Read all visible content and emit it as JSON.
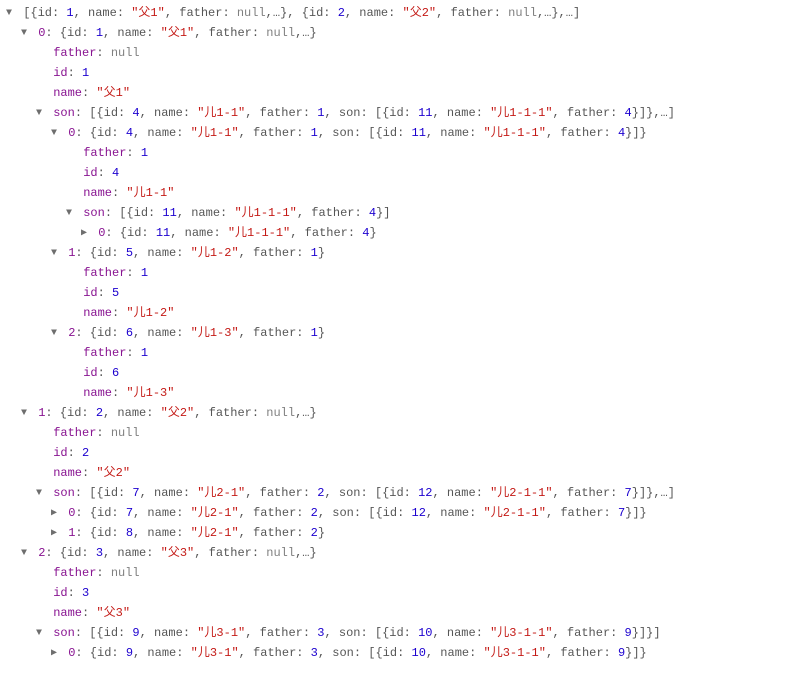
{
  "indentUnit": 15,
  "arrowBase": 2,
  "arrows": {
    "down": "▼",
    "right": "▶",
    "none": " "
  },
  "rows": [
    {
      "depth": 0,
      "arrow": "down",
      "tokens": [
        {
          "t": "pun",
          "v": "[{"
        },
        {
          "t": "pun",
          "v": "id: "
        },
        {
          "t": "num",
          "v": "1"
        },
        {
          "t": "pun",
          "v": ", name: "
        },
        {
          "t": "str",
          "v": "\"父1\""
        },
        {
          "t": "pun",
          "v": ", father: "
        },
        {
          "t": "nul",
          "v": "null"
        },
        {
          "t": "pun",
          "v": ",…}, {id: "
        },
        {
          "t": "num",
          "v": "2"
        },
        {
          "t": "pun",
          "v": ", name: "
        },
        {
          "t": "str",
          "v": "\"父2\""
        },
        {
          "t": "pun",
          "v": ", father: "
        },
        {
          "t": "nul",
          "v": "null"
        },
        {
          "t": "pun",
          "v": ",…},…]"
        }
      ]
    },
    {
      "depth": 1,
      "arrow": "down",
      "tokens": [
        {
          "t": "key",
          "v": "0"
        },
        {
          "t": "pun",
          "v": ": {id: "
        },
        {
          "t": "num",
          "v": "1"
        },
        {
          "t": "pun",
          "v": ", name: "
        },
        {
          "t": "str",
          "v": "\"父1\""
        },
        {
          "t": "pun",
          "v": ", father: "
        },
        {
          "t": "nul",
          "v": "null"
        },
        {
          "t": "pun",
          "v": ",…}"
        }
      ]
    },
    {
      "depth": 2,
      "arrow": "none",
      "tokens": [
        {
          "t": "key",
          "v": "father"
        },
        {
          "t": "pun",
          "v": ": "
        },
        {
          "t": "nul",
          "v": "null"
        }
      ]
    },
    {
      "depth": 2,
      "arrow": "none",
      "tokens": [
        {
          "t": "key",
          "v": "id"
        },
        {
          "t": "pun",
          "v": ": "
        },
        {
          "t": "num",
          "v": "1"
        }
      ]
    },
    {
      "depth": 2,
      "arrow": "none",
      "tokens": [
        {
          "t": "key",
          "v": "name"
        },
        {
          "t": "pun",
          "v": ": "
        },
        {
          "t": "str",
          "v": "\"父1\""
        }
      ]
    },
    {
      "depth": 2,
      "arrow": "down",
      "tokens": [
        {
          "t": "key",
          "v": "son"
        },
        {
          "t": "pun",
          "v": ": [{id: "
        },
        {
          "t": "num",
          "v": "4"
        },
        {
          "t": "pun",
          "v": ", name: "
        },
        {
          "t": "str",
          "v": "\"儿1-1\""
        },
        {
          "t": "pun",
          "v": ", father: "
        },
        {
          "t": "num",
          "v": "1"
        },
        {
          "t": "pun",
          "v": ", son: [{id: "
        },
        {
          "t": "num",
          "v": "11"
        },
        {
          "t": "pun",
          "v": ", name: "
        },
        {
          "t": "str",
          "v": "\"儿1-1-1\""
        },
        {
          "t": "pun",
          "v": ", father: "
        },
        {
          "t": "num",
          "v": "4"
        },
        {
          "t": "pun",
          "v": "}]},…]"
        }
      ]
    },
    {
      "depth": 3,
      "arrow": "down",
      "tokens": [
        {
          "t": "key",
          "v": "0"
        },
        {
          "t": "pun",
          "v": ": {id: "
        },
        {
          "t": "num",
          "v": "4"
        },
        {
          "t": "pun",
          "v": ", name: "
        },
        {
          "t": "str",
          "v": "\"儿1-1\""
        },
        {
          "t": "pun",
          "v": ", father: "
        },
        {
          "t": "num",
          "v": "1"
        },
        {
          "t": "pun",
          "v": ", son: [{id: "
        },
        {
          "t": "num",
          "v": "11"
        },
        {
          "t": "pun",
          "v": ", name: "
        },
        {
          "t": "str",
          "v": "\"儿1-1-1\""
        },
        {
          "t": "pun",
          "v": ", father: "
        },
        {
          "t": "num",
          "v": "4"
        },
        {
          "t": "pun",
          "v": "}]}"
        }
      ]
    },
    {
      "depth": 4,
      "arrow": "none",
      "tokens": [
        {
          "t": "key",
          "v": "father"
        },
        {
          "t": "pun",
          "v": ": "
        },
        {
          "t": "num",
          "v": "1"
        }
      ]
    },
    {
      "depth": 4,
      "arrow": "none",
      "tokens": [
        {
          "t": "key",
          "v": "id"
        },
        {
          "t": "pun",
          "v": ": "
        },
        {
          "t": "num",
          "v": "4"
        }
      ]
    },
    {
      "depth": 4,
      "arrow": "none",
      "tokens": [
        {
          "t": "key",
          "v": "name"
        },
        {
          "t": "pun",
          "v": ": "
        },
        {
          "t": "str",
          "v": "\"儿1-1\""
        }
      ]
    },
    {
      "depth": 4,
      "arrow": "down",
      "tokens": [
        {
          "t": "key",
          "v": "son"
        },
        {
          "t": "pun",
          "v": ": [{id: "
        },
        {
          "t": "num",
          "v": "11"
        },
        {
          "t": "pun",
          "v": ", name: "
        },
        {
          "t": "str",
          "v": "\"儿1-1-1\""
        },
        {
          "t": "pun",
          "v": ", father: "
        },
        {
          "t": "num",
          "v": "4"
        },
        {
          "t": "pun",
          "v": "}]"
        }
      ]
    },
    {
      "depth": 5,
      "arrow": "right",
      "tokens": [
        {
          "t": "key",
          "v": "0"
        },
        {
          "t": "pun",
          "v": ": {id: "
        },
        {
          "t": "num",
          "v": "11"
        },
        {
          "t": "pun",
          "v": ", name: "
        },
        {
          "t": "str",
          "v": "\"儿1-1-1\""
        },
        {
          "t": "pun",
          "v": ", father: "
        },
        {
          "t": "num",
          "v": "4"
        },
        {
          "t": "pun",
          "v": "}"
        }
      ]
    },
    {
      "depth": 3,
      "arrow": "down",
      "tokens": [
        {
          "t": "key",
          "v": "1"
        },
        {
          "t": "pun",
          "v": ": {id: "
        },
        {
          "t": "num",
          "v": "5"
        },
        {
          "t": "pun",
          "v": ", name: "
        },
        {
          "t": "str",
          "v": "\"儿1-2\""
        },
        {
          "t": "pun",
          "v": ", father: "
        },
        {
          "t": "num",
          "v": "1"
        },
        {
          "t": "pun",
          "v": "}"
        }
      ]
    },
    {
      "depth": 4,
      "arrow": "none",
      "tokens": [
        {
          "t": "key",
          "v": "father"
        },
        {
          "t": "pun",
          "v": ": "
        },
        {
          "t": "num",
          "v": "1"
        }
      ]
    },
    {
      "depth": 4,
      "arrow": "none",
      "tokens": [
        {
          "t": "key",
          "v": "id"
        },
        {
          "t": "pun",
          "v": ": "
        },
        {
          "t": "num",
          "v": "5"
        }
      ]
    },
    {
      "depth": 4,
      "arrow": "none",
      "tokens": [
        {
          "t": "key",
          "v": "name"
        },
        {
          "t": "pun",
          "v": ": "
        },
        {
          "t": "str",
          "v": "\"儿1-2\""
        }
      ]
    },
    {
      "depth": 3,
      "arrow": "down",
      "tokens": [
        {
          "t": "key",
          "v": "2"
        },
        {
          "t": "pun",
          "v": ": {id: "
        },
        {
          "t": "num",
          "v": "6"
        },
        {
          "t": "pun",
          "v": ", name: "
        },
        {
          "t": "str",
          "v": "\"儿1-3\""
        },
        {
          "t": "pun",
          "v": ", father: "
        },
        {
          "t": "num",
          "v": "1"
        },
        {
          "t": "pun",
          "v": "}"
        }
      ]
    },
    {
      "depth": 4,
      "arrow": "none",
      "tokens": [
        {
          "t": "key",
          "v": "father"
        },
        {
          "t": "pun",
          "v": ": "
        },
        {
          "t": "num",
          "v": "1"
        }
      ]
    },
    {
      "depth": 4,
      "arrow": "none",
      "tokens": [
        {
          "t": "key",
          "v": "id"
        },
        {
          "t": "pun",
          "v": ": "
        },
        {
          "t": "num",
          "v": "6"
        }
      ]
    },
    {
      "depth": 4,
      "arrow": "none",
      "tokens": [
        {
          "t": "key",
          "v": "name"
        },
        {
          "t": "pun",
          "v": ": "
        },
        {
          "t": "str",
          "v": "\"儿1-3\""
        }
      ]
    },
    {
      "depth": 1,
      "arrow": "down",
      "tokens": [
        {
          "t": "key",
          "v": "1"
        },
        {
          "t": "pun",
          "v": ": {id: "
        },
        {
          "t": "num",
          "v": "2"
        },
        {
          "t": "pun",
          "v": ", name: "
        },
        {
          "t": "str",
          "v": "\"父2\""
        },
        {
          "t": "pun",
          "v": ", father: "
        },
        {
          "t": "nul",
          "v": "null"
        },
        {
          "t": "pun",
          "v": ",…}"
        }
      ]
    },
    {
      "depth": 2,
      "arrow": "none",
      "tokens": [
        {
          "t": "key",
          "v": "father"
        },
        {
          "t": "pun",
          "v": ": "
        },
        {
          "t": "nul",
          "v": "null"
        }
      ]
    },
    {
      "depth": 2,
      "arrow": "none",
      "tokens": [
        {
          "t": "key",
          "v": "id"
        },
        {
          "t": "pun",
          "v": ": "
        },
        {
          "t": "num",
          "v": "2"
        }
      ]
    },
    {
      "depth": 2,
      "arrow": "none",
      "tokens": [
        {
          "t": "key",
          "v": "name"
        },
        {
          "t": "pun",
          "v": ": "
        },
        {
          "t": "str",
          "v": "\"父2\""
        }
      ]
    },
    {
      "depth": 2,
      "arrow": "down",
      "tokens": [
        {
          "t": "key",
          "v": "son"
        },
        {
          "t": "pun",
          "v": ": [{id: "
        },
        {
          "t": "num",
          "v": "7"
        },
        {
          "t": "pun",
          "v": ", name: "
        },
        {
          "t": "str",
          "v": "\"儿2-1\""
        },
        {
          "t": "pun",
          "v": ", father: "
        },
        {
          "t": "num",
          "v": "2"
        },
        {
          "t": "pun",
          "v": ", son: [{id: "
        },
        {
          "t": "num",
          "v": "12"
        },
        {
          "t": "pun",
          "v": ", name: "
        },
        {
          "t": "str",
          "v": "\"儿2-1-1\""
        },
        {
          "t": "pun",
          "v": ", father: "
        },
        {
          "t": "num",
          "v": "7"
        },
        {
          "t": "pun",
          "v": "}]},…]"
        }
      ]
    },
    {
      "depth": 3,
      "arrow": "right",
      "tokens": [
        {
          "t": "key",
          "v": "0"
        },
        {
          "t": "pun",
          "v": ": {id: "
        },
        {
          "t": "num",
          "v": "7"
        },
        {
          "t": "pun",
          "v": ", name: "
        },
        {
          "t": "str",
          "v": "\"儿2-1\""
        },
        {
          "t": "pun",
          "v": ", father: "
        },
        {
          "t": "num",
          "v": "2"
        },
        {
          "t": "pun",
          "v": ", son: [{id: "
        },
        {
          "t": "num",
          "v": "12"
        },
        {
          "t": "pun",
          "v": ", name: "
        },
        {
          "t": "str",
          "v": "\"儿2-1-1\""
        },
        {
          "t": "pun",
          "v": ", father: "
        },
        {
          "t": "num",
          "v": "7"
        },
        {
          "t": "pun",
          "v": "}]}"
        }
      ]
    },
    {
      "depth": 3,
      "arrow": "right",
      "tokens": [
        {
          "t": "key",
          "v": "1"
        },
        {
          "t": "pun",
          "v": ": {id: "
        },
        {
          "t": "num",
          "v": "8"
        },
        {
          "t": "pun",
          "v": ", name: "
        },
        {
          "t": "str",
          "v": "\"儿2-1\""
        },
        {
          "t": "pun",
          "v": ", father: "
        },
        {
          "t": "num",
          "v": "2"
        },
        {
          "t": "pun",
          "v": "}"
        }
      ]
    },
    {
      "depth": 1,
      "arrow": "down",
      "tokens": [
        {
          "t": "key",
          "v": "2"
        },
        {
          "t": "pun",
          "v": ": {id: "
        },
        {
          "t": "num",
          "v": "3"
        },
        {
          "t": "pun",
          "v": ", name: "
        },
        {
          "t": "str",
          "v": "\"父3\""
        },
        {
          "t": "pun",
          "v": ", father: "
        },
        {
          "t": "nul",
          "v": "null"
        },
        {
          "t": "pun",
          "v": ",…}"
        }
      ]
    },
    {
      "depth": 2,
      "arrow": "none",
      "tokens": [
        {
          "t": "key",
          "v": "father"
        },
        {
          "t": "pun",
          "v": ": "
        },
        {
          "t": "nul",
          "v": "null"
        }
      ]
    },
    {
      "depth": 2,
      "arrow": "none",
      "tokens": [
        {
          "t": "key",
          "v": "id"
        },
        {
          "t": "pun",
          "v": ": "
        },
        {
          "t": "num",
          "v": "3"
        }
      ]
    },
    {
      "depth": 2,
      "arrow": "none",
      "tokens": [
        {
          "t": "key",
          "v": "name"
        },
        {
          "t": "pun",
          "v": ": "
        },
        {
          "t": "str",
          "v": "\"父3\""
        }
      ]
    },
    {
      "depth": 2,
      "arrow": "down",
      "tokens": [
        {
          "t": "key",
          "v": "son"
        },
        {
          "t": "pun",
          "v": ": [{id: "
        },
        {
          "t": "num",
          "v": "9"
        },
        {
          "t": "pun",
          "v": ", name: "
        },
        {
          "t": "str",
          "v": "\"儿3-1\""
        },
        {
          "t": "pun",
          "v": ", father: "
        },
        {
          "t": "num",
          "v": "3"
        },
        {
          "t": "pun",
          "v": ", son: [{id: "
        },
        {
          "t": "num",
          "v": "10"
        },
        {
          "t": "pun",
          "v": ", name: "
        },
        {
          "t": "str",
          "v": "\"儿3-1-1\""
        },
        {
          "t": "pun",
          "v": ", father: "
        },
        {
          "t": "num",
          "v": "9"
        },
        {
          "t": "pun",
          "v": "}]}]"
        }
      ]
    },
    {
      "depth": 3,
      "arrow": "right",
      "tokens": [
        {
          "t": "key",
          "v": "0"
        },
        {
          "t": "pun",
          "v": ": {id: "
        },
        {
          "t": "num",
          "v": "9"
        },
        {
          "t": "pun",
          "v": ", name: "
        },
        {
          "t": "str",
          "v": "\"儿3-1\""
        },
        {
          "t": "pun",
          "v": ", father: "
        },
        {
          "t": "num",
          "v": "3"
        },
        {
          "t": "pun",
          "v": ", son: [{id: "
        },
        {
          "t": "num",
          "v": "10"
        },
        {
          "t": "pun",
          "v": ", name: "
        },
        {
          "t": "str",
          "v": "\"儿3-1-1\""
        },
        {
          "t": "pun",
          "v": ", father: "
        },
        {
          "t": "num",
          "v": "9"
        },
        {
          "t": "pun",
          "v": "}]}"
        }
      ]
    }
  ]
}
